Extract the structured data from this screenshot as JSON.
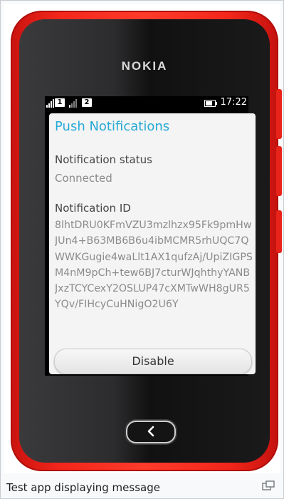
{
  "phone": {
    "brand": "NOKIA"
  },
  "statusbar": {
    "sim1": "1",
    "sim2": "2",
    "time": "17:22",
    "battery_level": 0.75
  },
  "card": {
    "title": "Push Notifications",
    "status_label": "Notification status",
    "status_value": "Connected",
    "id_label": "Notification ID",
    "id_value": "8lhtDRU0KFmVZU3mzlhzx95Fk9pmHwJUn4+B63MB6B6u4ibMCMR5rhUQC7QWWKGugie4waLlt1AX1qufzAj/UpiZIGPSM4nM9pCh+tew6BJ7cturWJqhthyYANBJxzTCYCexY2OSLUP47cXMTwWH8gUR5YQv/FIHcyCuHNigO2U6Y",
    "disable_label": "Disable"
  },
  "caption": {
    "text": "Test app displaying message"
  },
  "icons": {
    "back": "chevron-left-icon",
    "enlarge": "magnify-icon"
  }
}
